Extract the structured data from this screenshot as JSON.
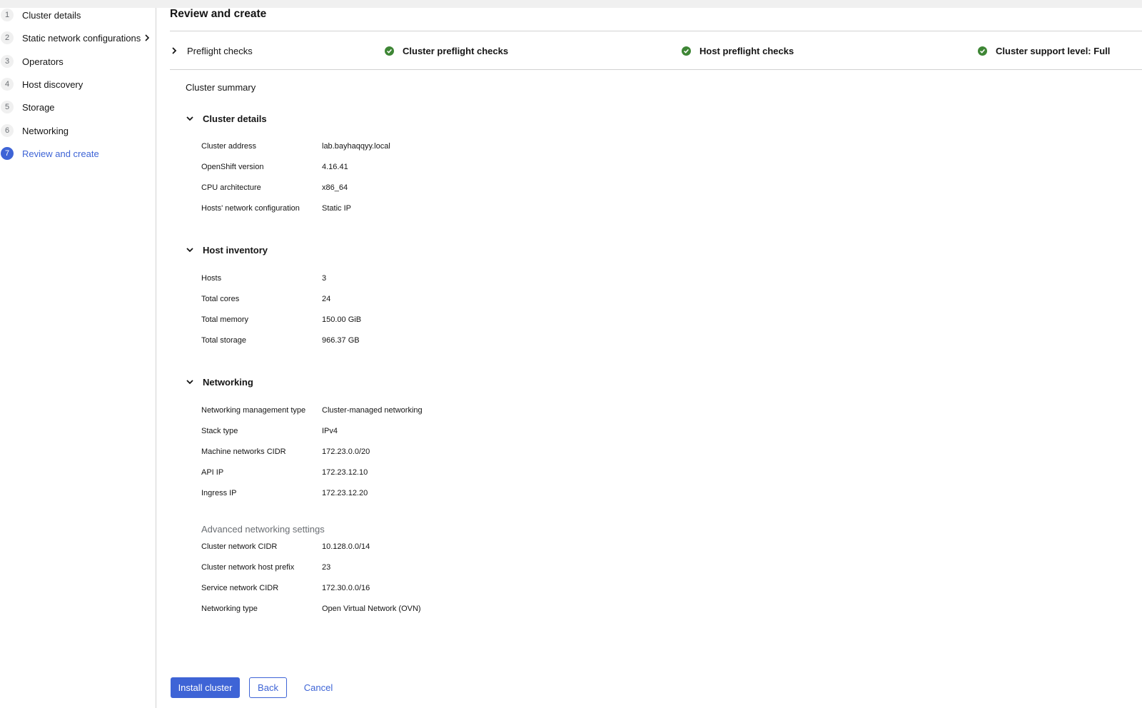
{
  "wizard": {
    "steps": [
      {
        "num": "1",
        "label": "Cluster details"
      },
      {
        "num": "2",
        "label": "Static network configurations"
      },
      {
        "num": "3",
        "label": "Operators"
      },
      {
        "num": "4",
        "label": "Host discovery"
      },
      {
        "num": "5",
        "label": "Storage"
      },
      {
        "num": "6",
        "label": "Networking"
      },
      {
        "num": "7",
        "label": "Review and create"
      }
    ],
    "active_step": "7"
  },
  "page": {
    "title": "Review and create"
  },
  "preflight": {
    "toggle_label": "Preflight checks",
    "checks": [
      {
        "label": "Cluster preflight checks",
        "status": "success"
      },
      {
        "label": "Host preflight checks",
        "status": "success"
      },
      {
        "label": "Cluster support level: Full",
        "status": "success"
      }
    ]
  },
  "summary": {
    "title": "Cluster summary",
    "cluster_details": {
      "title": "Cluster details",
      "rows": [
        {
          "key": "Cluster address",
          "value": "lab.bayhaqqyy.local"
        },
        {
          "key": "OpenShift version",
          "value": "4.16.41"
        },
        {
          "key": "CPU architecture",
          "value": "x86_64"
        },
        {
          "key": "Hosts' network configuration",
          "value": "Static IP"
        }
      ]
    },
    "host_inventory": {
      "title": "Host inventory",
      "rows": [
        {
          "key": "Hosts",
          "value": "3"
        },
        {
          "key": "Total cores",
          "value": "24"
        },
        {
          "key": "Total memory",
          "value": "150.00 GiB"
        },
        {
          "key": "Total storage",
          "value": "966.37 GB"
        }
      ]
    },
    "networking": {
      "title": "Networking",
      "rows": [
        {
          "key": "Networking management type",
          "value": "Cluster-managed networking"
        },
        {
          "key": "Stack type",
          "value": "IPv4"
        },
        {
          "key": "Machine networks CIDR",
          "value": "172.23.0.0/20"
        },
        {
          "key": "API IP",
          "value": "172.23.12.10"
        },
        {
          "key": "Ingress IP",
          "value": "172.23.12.20"
        }
      ],
      "advanced_title": "Advanced networking settings",
      "advanced_rows": [
        {
          "key": "Cluster network CIDR",
          "value": "10.128.0.0/14"
        },
        {
          "key": "Cluster network host prefix",
          "value": "23"
        },
        {
          "key": "Service network CIDR",
          "value": "172.30.0.0/16"
        },
        {
          "key": "Networking type",
          "value": "Open Virtual Network (OVN)"
        }
      ]
    }
  },
  "actions": {
    "install_label": "Install cluster",
    "back_label": "Back",
    "cancel_label": "Cancel"
  },
  "colors": {
    "accent": "#3e64d6",
    "success": "#3e8635",
    "border": "#d2d2d2"
  }
}
